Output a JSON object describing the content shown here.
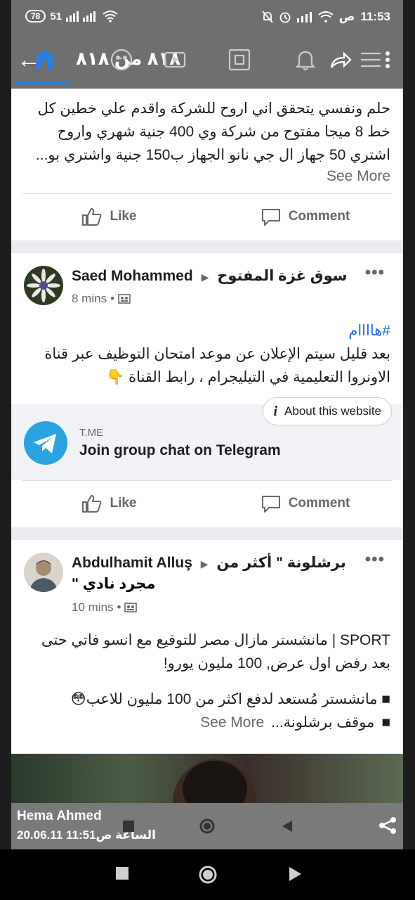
{
  "status_bar": {
    "battery": "78",
    "time": "11:53",
    "ampm": "ص",
    "signal_text": "51"
  },
  "top_nav": {
    "counter_text": "٨١٨ من ٨١٨"
  },
  "post1": {
    "text": "حلم ونفسي يتحقق اني اروح للشركة واقدم علي خطين كل خط 8 ميجا مفتوح  من شركة وي 400 جنية شهري واروح اشتري 50 جهاز ال جي نانو الجهاز ب150 جنية واشتري بو...",
    "see_more": "See More",
    "like_label": "Like",
    "comment_label": "Comment"
  },
  "post2": {
    "author": "Saed Mohammed",
    "group": "سوق غزة المفتوح",
    "time": "8 mins",
    "hashtag": "#هاااام",
    "text": "بعد قليل سيتم الإعلان عن موعد امتحان التوظيف عبر قناة الاونروا التعليمية في التيليجرام ، رابط القناة",
    "emoji": "👇",
    "about_label": "About this website",
    "link_domain": "T.ME",
    "link_title": "Join group chat on Telegram",
    "like_label": "Like",
    "comment_label": "Comment"
  },
  "post3": {
    "author": "Abdulhamit Alluş",
    "group_line1": "برشلونة \" أكثر من",
    "group_line2": "مجرد نادي \"",
    "time": "10 mins",
    "text": "SPORT | مانشستر مازال مصر للتوقيع مع انسو فاتي حتى بعد رفض اول عرض, 100 مليون يورو!",
    "bullet1": "مانشستر مُستعد لدفع اكثر من 100 مليون للاعب",
    "bullet1_emoji": "😳",
    "bullet2": "موقف برشلونة...",
    "see_more": "See More"
  },
  "overlay": {
    "name": "Hema Ahmed",
    "date": "20.06.11 الساعة  ص11:51"
  },
  "colors": {
    "facebook_blue": "#216fdb",
    "telegram_blue": "#2aa3e0",
    "text_gray": "#65676b"
  }
}
